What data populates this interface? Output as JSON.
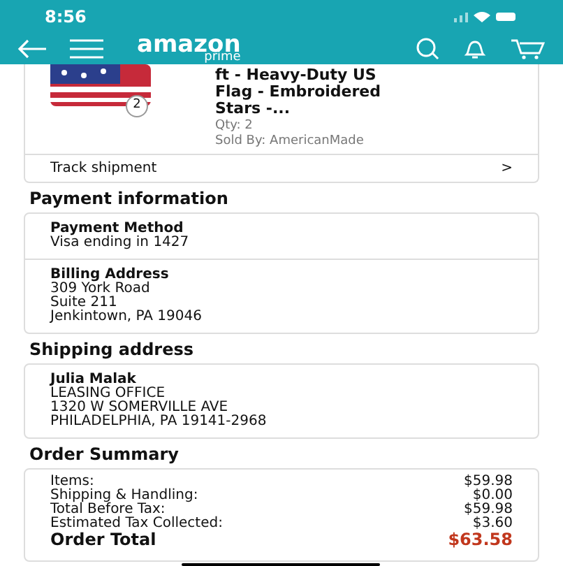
{
  "status_bar": {
    "time": "8:56"
  },
  "header": {
    "logo": "amazon",
    "logo_sub": "prime"
  },
  "order_item": {
    "title": "ft - Heavy-Duty US Flag - Embroidered Stars -...",
    "quantity_badge": "2",
    "qty": "Qty: 2",
    "sold_by": "Sold By: AmericanMade"
  },
  "track_shipment": {
    "label": "Track shipment",
    "chevron": ">"
  },
  "payment": {
    "heading": "Payment information",
    "sections": [
      {
        "title": "Payment Method",
        "lines": [
          "Visa ending in 1427"
        ]
      },
      {
        "title": "Billing Address",
        "lines": [
          "309 York Road",
          "Suite 211",
          "Jenkintown, PA 19046"
        ]
      }
    ]
  },
  "shipping": {
    "heading": "Shipping address",
    "name": "Julia Malak",
    "lines": [
      "LEASING OFFICE",
      "1320 W SOMERVILLE AVE",
      "PHILADELPHIA, PA 19141-2968"
    ]
  },
  "summary": {
    "heading": "Order Summary",
    "rows": [
      {
        "kind": "line",
        "label": "Items:",
        "value": "$59.98"
      },
      {
        "kind": "line",
        "label": "Shipping & Handling:",
        "value": "$0.00"
      },
      {
        "kind": "line",
        "label": "Total Before Tax:",
        "value": "$59.98"
      },
      {
        "kind": "line",
        "label": "Estimated Tax Collected:",
        "value": "$3.60"
      },
      {
        "kind": "total",
        "label": "Order Total",
        "value": "$63.58"
      }
    ]
  }
}
